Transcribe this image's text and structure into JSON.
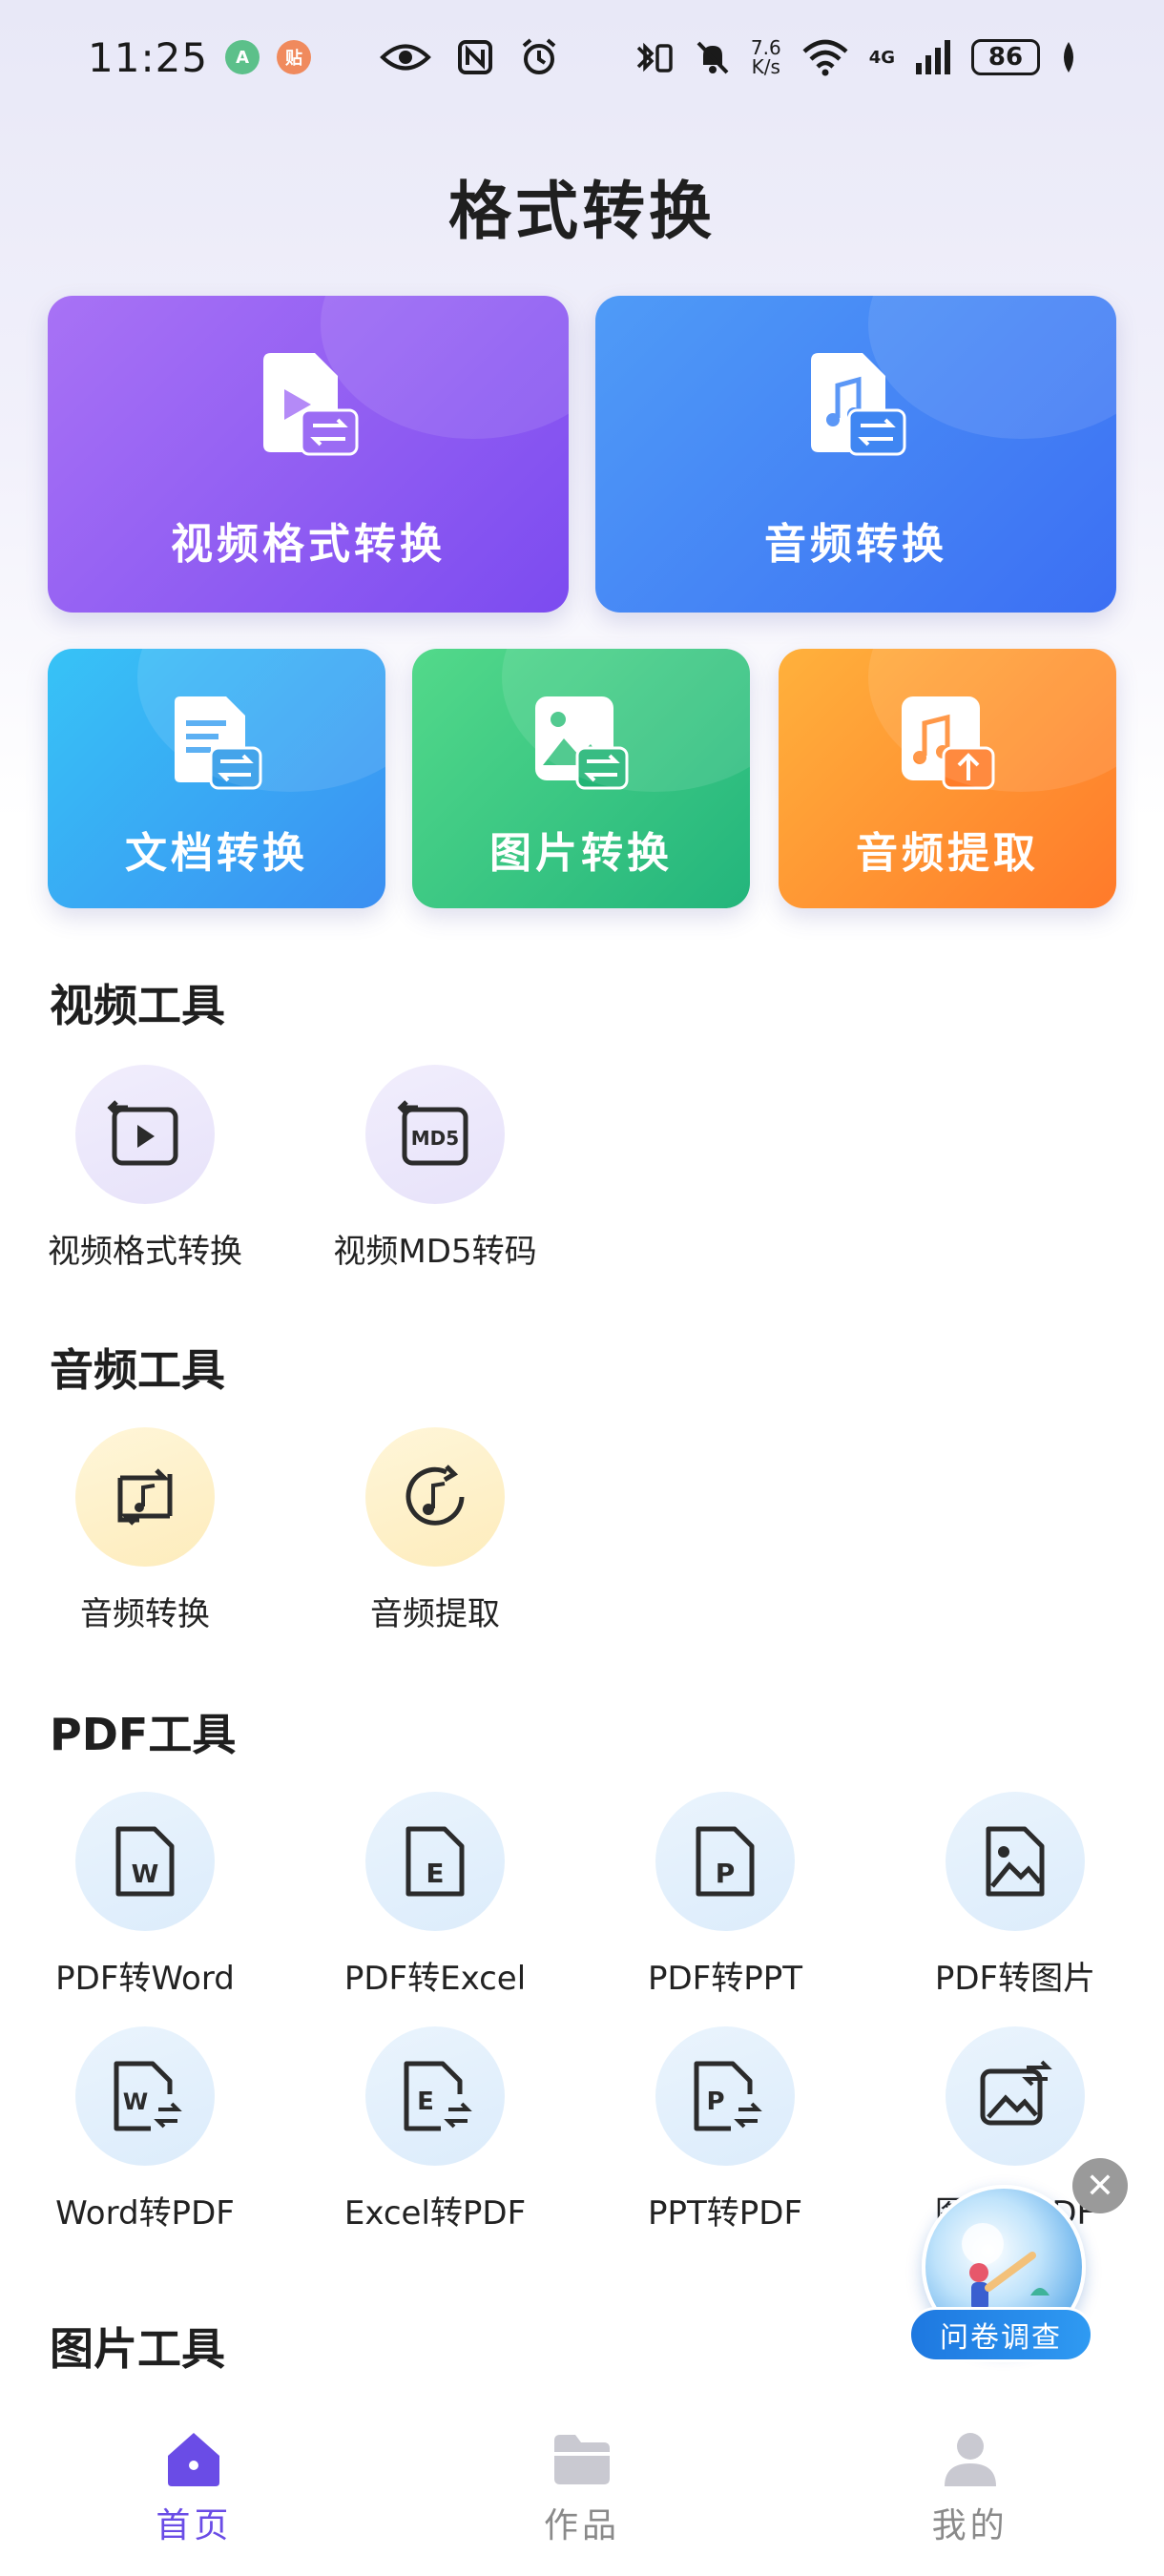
{
  "status_bar": {
    "time": "11:25",
    "notif1": "A",
    "notif2": "贴",
    "speed_value": "7.6",
    "speed_unit": "K/s",
    "network": "4G",
    "battery": "86"
  },
  "page_title": "格式转换",
  "feature_cards": [
    {
      "label": "视频格式转换",
      "color_from": "#a872f5",
      "color_to": "#7c4bf0"
    },
    {
      "label": "音频转换",
      "color_from": "#4f9bf7",
      "color_to": "#3c6ff3"
    },
    {
      "label": "文档转换",
      "color_from": "#37c3f6",
      "color_to": "#3b8ff2"
    },
    {
      "label": "图片转换",
      "color_from": "#53d98a",
      "color_to": "#23b57c"
    },
    {
      "label": "音频提取",
      "color_from": "#ffb13c",
      "color_to": "#ff7a2a"
    }
  ],
  "sections": {
    "video": {
      "title": "视频工具",
      "tools": [
        {
          "label": "视频格式转换",
          "icon": "video-convert-icon"
        },
        {
          "label": "视频MD5转码",
          "icon": "md5-icon",
          "badge": "MD5"
        }
      ]
    },
    "audio": {
      "title": "音频工具",
      "tools": [
        {
          "label": "音频转换",
          "icon": "audio-convert-icon"
        },
        {
          "label": "音频提取",
          "icon": "audio-extract-icon"
        }
      ]
    },
    "pdf": {
      "title": "PDF工具",
      "tools": [
        {
          "label": "PDF转Word",
          "icon": "word-doc-icon",
          "letter": "W"
        },
        {
          "label": "PDF转Excel",
          "icon": "excel-doc-icon",
          "letter": "E"
        },
        {
          "label": "PDF转PPT",
          "icon": "ppt-doc-icon",
          "letter": "P"
        },
        {
          "label": "PDF转图片",
          "icon": "image-doc-icon"
        },
        {
          "label": "Word转PDF",
          "icon": "word-to-pdf-icon",
          "letter": "W"
        },
        {
          "label": "Excel转PDF",
          "icon": "excel-to-pdf-icon",
          "letter": "E"
        },
        {
          "label": "PPT转PDF",
          "icon": "ppt-to-pdf-icon",
          "letter": "P"
        },
        {
          "label": "图片转PDF",
          "icon": "image-to-pdf-icon"
        }
      ]
    },
    "image": {
      "title": "图片工具"
    }
  },
  "survey": {
    "label": "问卷调查",
    "close": "✕"
  },
  "bottom_nav": [
    {
      "label": "首页",
      "icon": "home-icon",
      "active": true
    },
    {
      "label": "作品",
      "icon": "folder-icon",
      "active": false
    },
    {
      "label": "我的",
      "icon": "profile-icon",
      "active": false
    }
  ],
  "colors": {
    "accent": "#6a4ce6",
    "icon_stroke": "#2b2b2b"
  }
}
